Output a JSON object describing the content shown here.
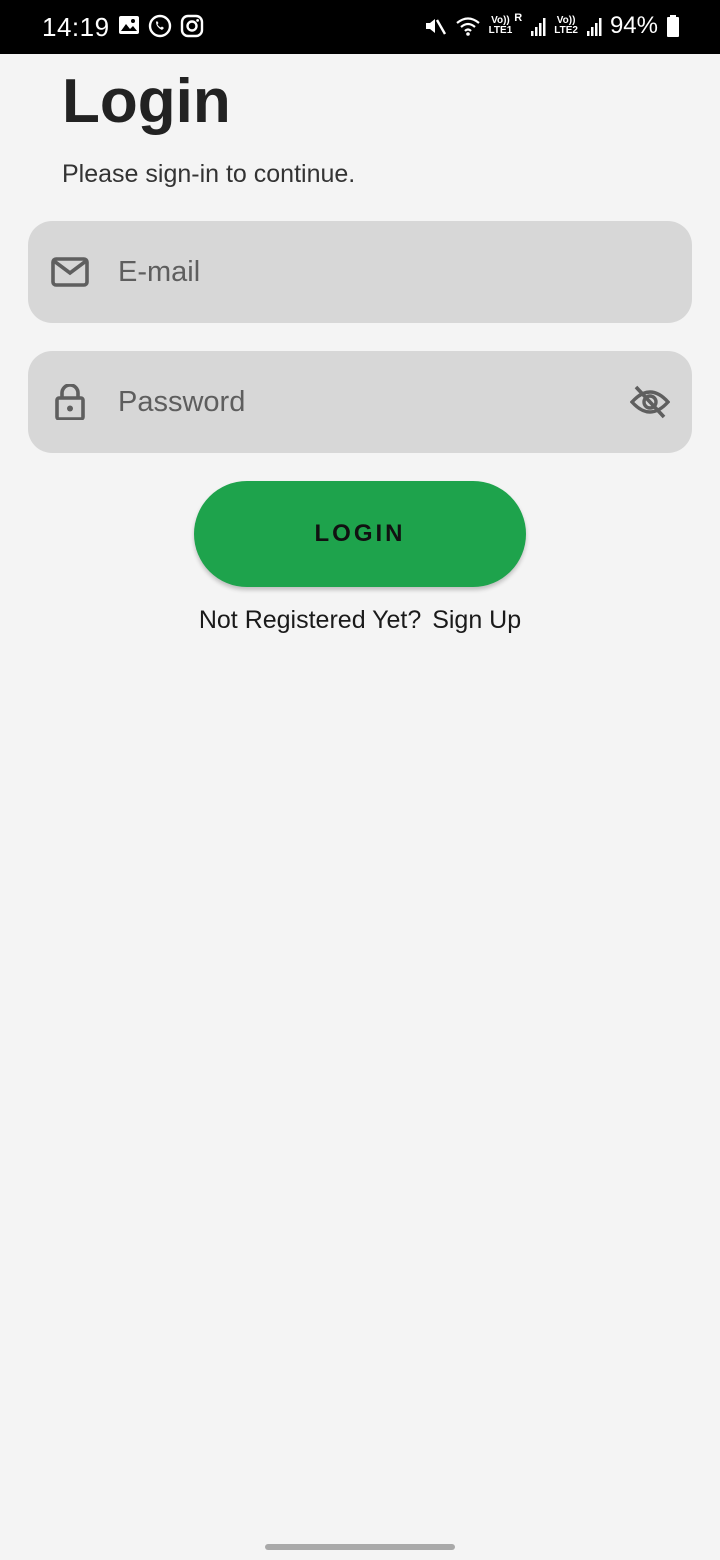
{
  "status_bar": {
    "time": "14:19",
    "left_icons": [
      "gallery-icon",
      "whatsapp-icon",
      "instagram-icon"
    ],
    "right_icons": [
      "mute-icon",
      "wifi-icon",
      "signal-sim1-icon",
      "signal-sim2-icon",
      "battery-icon"
    ],
    "sim1_label_top": "Vo))",
    "sim1_label_bottom": "LTE1",
    "sim1_roaming": "R",
    "sim2_label_top": "Vo))",
    "sim2_label_bottom": "LTE2",
    "battery": "94%"
  },
  "login": {
    "title": "Login",
    "subtitle": "Please sign-in to continue.",
    "email_placeholder": "E-mail",
    "email_icon": "mail-icon",
    "password_placeholder": "Password",
    "password_icon": "lock-icon",
    "password_toggle_icon": "eye-off-icon",
    "button_label": "LOGIN",
    "signup_prompt": "Not Registered Yet?",
    "signup_link": "Sign Up"
  },
  "colors": {
    "background": "#f4f4f4",
    "field": "#d7d7d7",
    "accent": "#1ea34c",
    "status_bar": "#000000"
  }
}
